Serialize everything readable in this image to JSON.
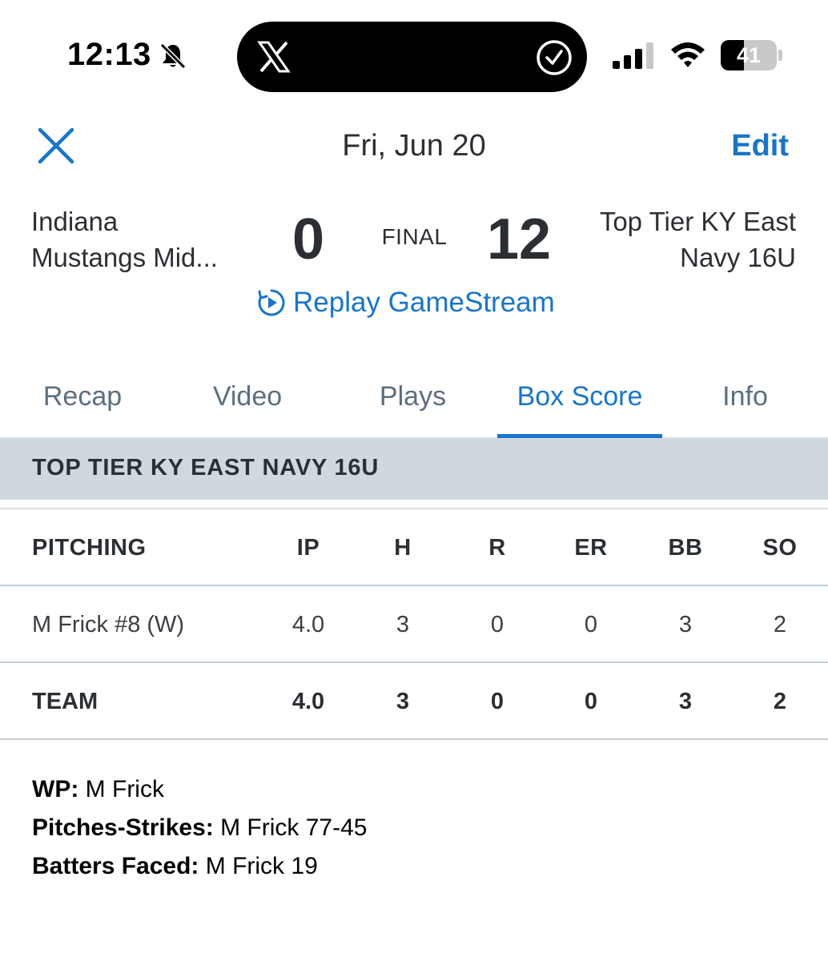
{
  "status_bar": {
    "time": "12:13",
    "battery_level": "41",
    "battery_fraction": 0.41,
    "icons": [
      "bell-slash-icon",
      "x-logo-icon",
      "check-circle-icon",
      "signal-icon",
      "wifi-icon",
      "battery-icon"
    ]
  },
  "header": {
    "date": "Fri, Jun 20",
    "edit_label": "Edit",
    "close_icon": "close-icon"
  },
  "game": {
    "away_team_line1": "Indiana",
    "away_team_line2": "Mustangs Mid...",
    "away_score": "0",
    "status": "FINAL",
    "home_score": "12",
    "home_team_line1": "Top Tier KY East",
    "home_team_line2": "Navy 16U",
    "replay_label": "Replay GameStream"
  },
  "tabs": [
    {
      "label": "Recap"
    },
    {
      "label": "Video"
    },
    {
      "label": "Plays"
    },
    {
      "label": "Box Score"
    },
    {
      "label": "Info"
    }
  ],
  "active_tab": "Box Score",
  "colors": {
    "accent": "#1a75c8",
    "section_bg": "#cfd8de",
    "text": "#2b2f33",
    "tab_inactive": "#5c6f80"
  },
  "box_score": {
    "team_header": "TOP TIER KY EAST NAVY 16U",
    "columns": [
      "PITCHING",
      "IP",
      "H",
      "R",
      "ER",
      "BB",
      "SO"
    ],
    "players": [
      {
        "name": "M Frick #8 (W)",
        "stats": [
          "4.0",
          "3",
          "0",
          "0",
          "3",
          "2"
        ]
      }
    ],
    "team_total": {
      "name": "TEAM",
      "stats": [
        "4.0",
        "3",
        "0",
        "0",
        "3",
        "2"
      ]
    }
  },
  "notes": [
    {
      "label": "WP:",
      "value": " M Frick"
    },
    {
      "label": "Pitches-Strikes:",
      "value": " M Frick 77-45"
    },
    {
      "label": "Batters Faced:",
      "value": " M Frick 19"
    }
  ]
}
